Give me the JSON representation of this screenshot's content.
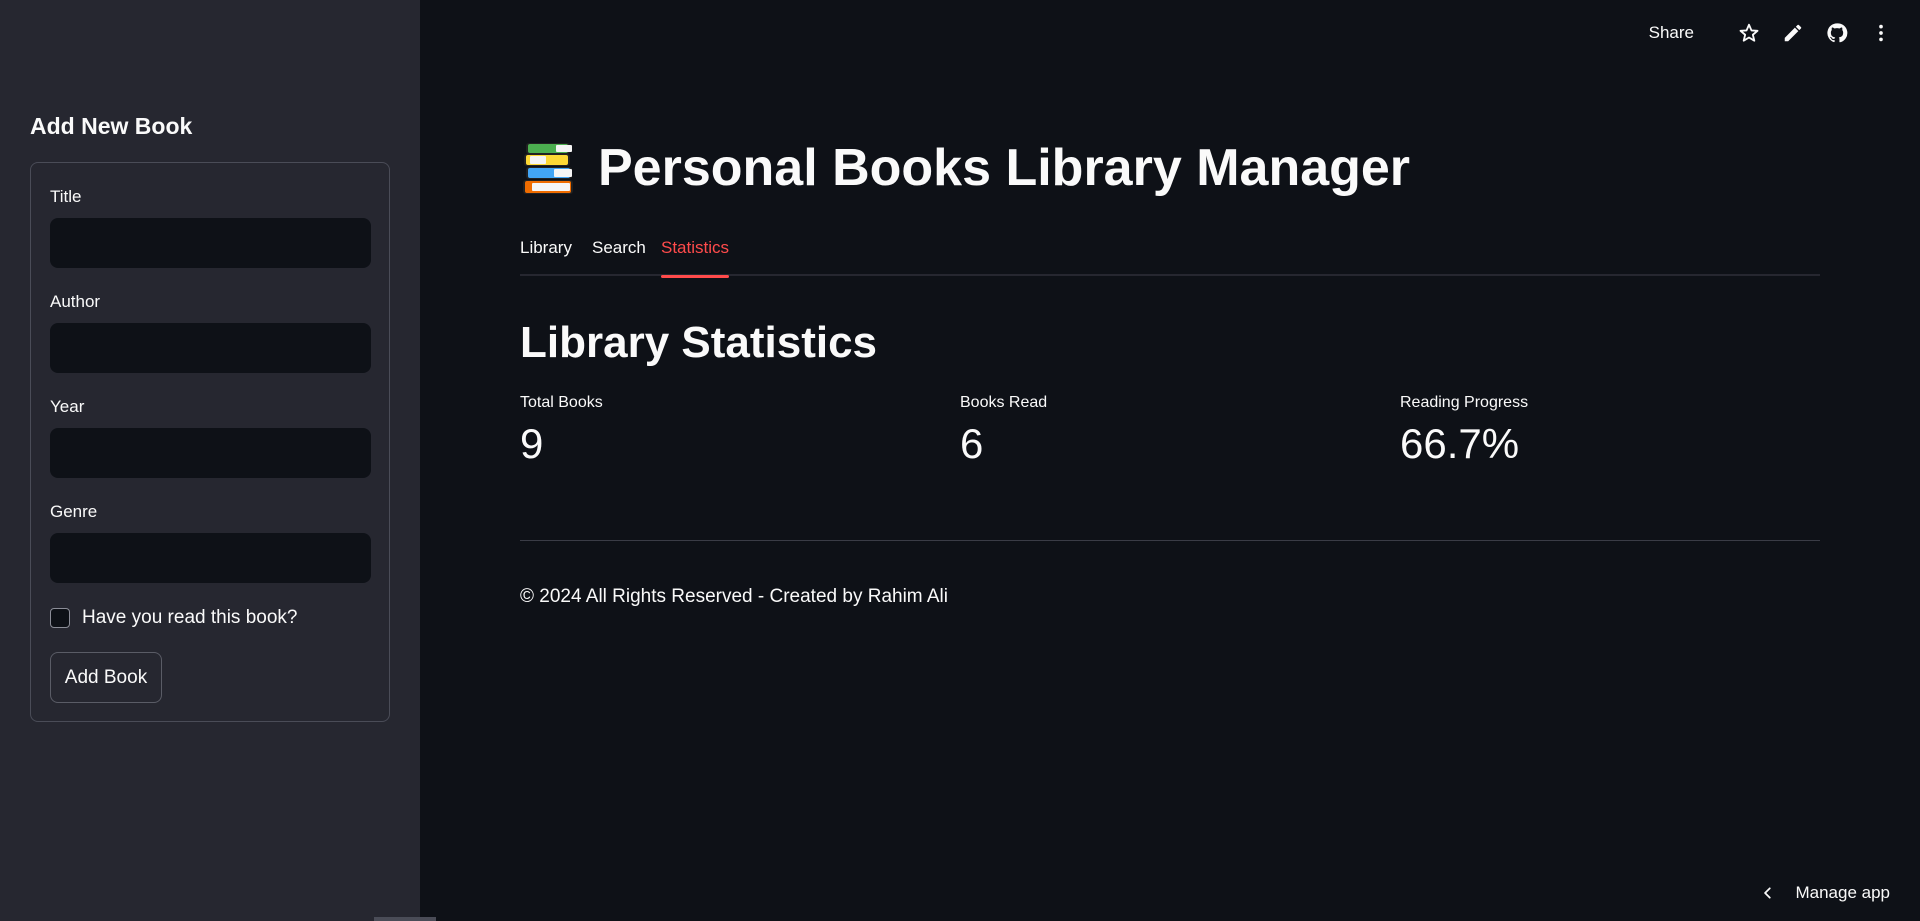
{
  "sidebar": {
    "header": "Add New Book",
    "fields": {
      "title": {
        "label": "Title",
        "value": ""
      },
      "author": {
        "label": "Author",
        "value": ""
      },
      "year": {
        "label": "Year",
        "value": ""
      },
      "genre": {
        "label": "Genre",
        "value": ""
      }
    },
    "read_checkbox": {
      "label": "Have you read this book?",
      "checked": false
    },
    "add_button": "Add Book"
  },
  "toolbar": {
    "share": "Share",
    "icons": [
      "star-icon",
      "pencil-icon",
      "github-icon",
      "more-vertical-icon"
    ]
  },
  "main": {
    "title": "Personal Books Library Manager",
    "title_icon": "books-emoji-icon",
    "tabs": [
      {
        "label": "Library",
        "active": false
      },
      {
        "label": "Search",
        "active": false
      },
      {
        "label": "Statistics",
        "active": true
      }
    ],
    "section_title": "Library Statistics",
    "metrics": [
      {
        "label": "Total Books",
        "value": "9"
      },
      {
        "label": "Books Read",
        "value": "6"
      },
      {
        "label": "Reading Progress",
        "value": "66.7%"
      }
    ],
    "footer": "© 2024 All Rights Reserved - Created by Rahim Ali"
  },
  "manage_app": "Manage app",
  "colors": {
    "background": "#0e1117",
    "sidebar": "#262730",
    "accent": "#ff4b4b",
    "text": "#fafafa"
  }
}
